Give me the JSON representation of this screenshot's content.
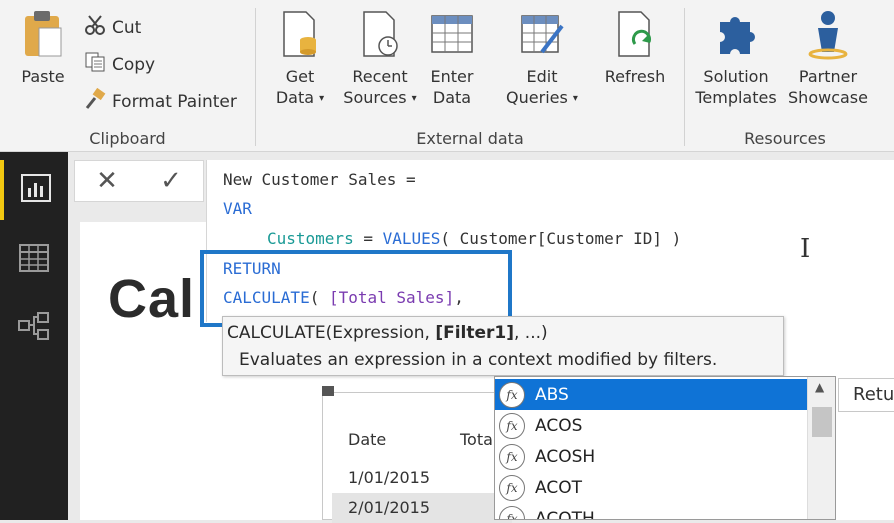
{
  "ribbon": {
    "clipboard": {
      "label": "Clipboard",
      "paste": "Paste",
      "cut": "Cut",
      "copy": "Copy",
      "format_painter": "Format Painter"
    },
    "external_data": {
      "label": "External data",
      "get_data": [
        "Get",
        "Data"
      ],
      "recent_sources": [
        "Recent",
        "Sources"
      ],
      "enter_data": [
        "Enter",
        "Data"
      ],
      "edit_queries": [
        "Edit",
        "Queries"
      ],
      "refresh": "Refresh"
    },
    "resources": {
      "label": "Resources",
      "solution_templates": [
        "Solution",
        "Templates"
      ],
      "partner_showcase": [
        "Partner",
        "Showcase"
      ]
    },
    "dropdown_caret": "▾"
  },
  "formula_bar": {
    "cancel_symbol": "✕",
    "commit_symbol": "✓",
    "line1": "New Customer Sales =",
    "line2": "VAR",
    "line3_var": "Customers",
    "line3_eq": " = ",
    "line3_fn": "VALUES",
    "line3_args": "( Customer[Customer ID] )",
    "line4": "RETURN",
    "line5_fn": "CALCULATE",
    "line5_paren": "( ",
    "line5_measure": "[Total Sales]",
    "line5_comma": ","
  },
  "tooltip": {
    "signature_prefix": "CALCULATE(Expression, ",
    "signature_bold": "[Filter1]",
    "signature_suffix": ", ...)",
    "description": "Evaluates an expression in a context modified by filters."
  },
  "autocomplete": {
    "icon_glyph": "fx",
    "items": [
      "ABS",
      "ACOS",
      "ACOSH",
      "ACOT",
      "ACOTH"
    ],
    "selected_index": 0
  },
  "canvas": {
    "title_fragment": "Cal",
    "table_headers": [
      "Date",
      "Tota"
    ],
    "table_rows": [
      "1/01/2015",
      "2/01/2015"
    ],
    "side_box_text": "Retu"
  },
  "colors": {
    "accent_nav": "#f2c811",
    "highlight": "#1f77c8",
    "selection": "#0f73d6",
    "keyword": "#2a6cd4"
  }
}
